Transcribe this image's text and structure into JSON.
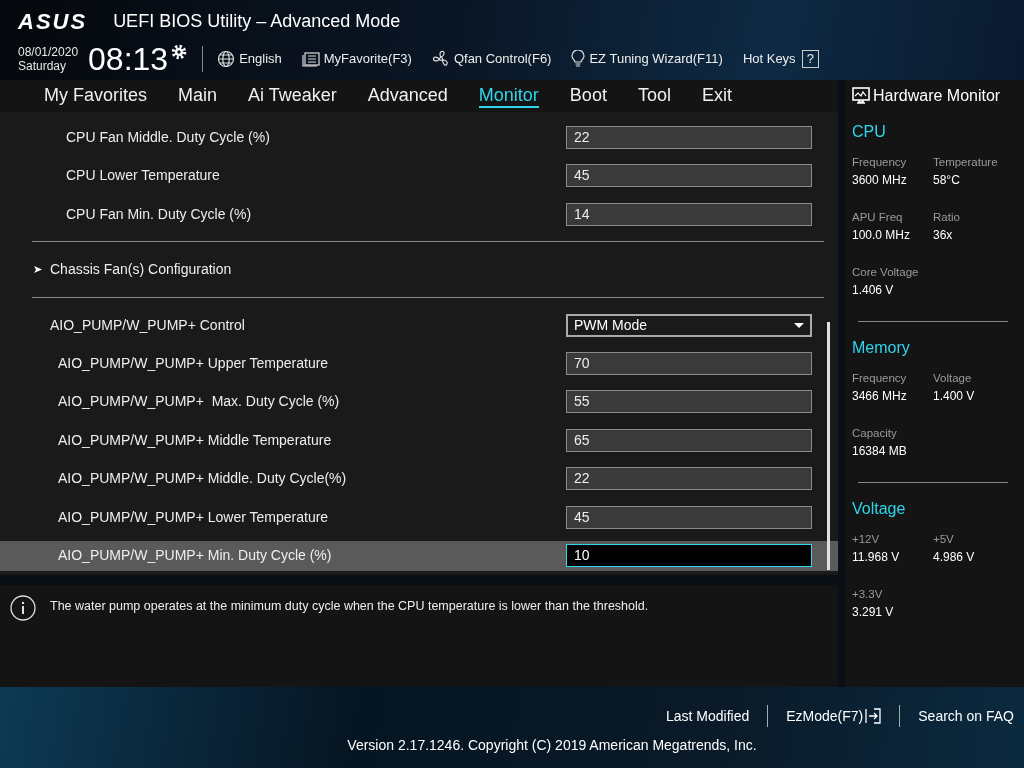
{
  "header": {
    "brand": "ASUS",
    "title": "UEFI BIOS Utility – Advanced Mode",
    "date": "08/01/2020",
    "day": "Saturday",
    "time": "08:13",
    "tools": [
      {
        "kind": "globe",
        "label": "English"
      },
      {
        "kind": "list",
        "label": "MyFavorite(F3)"
      },
      {
        "kind": "fan",
        "label": "Qfan Control(F6)"
      },
      {
        "kind": "bulb",
        "label": "EZ Tuning Wizard(F11)"
      },
      {
        "kind": "help",
        "label": "Hot Keys",
        "key": "?"
      }
    ]
  },
  "tabs": [
    {
      "label": "My Favorites",
      "selected": false
    },
    {
      "label": "Main",
      "selected": false
    },
    {
      "label": "Ai Tweaker",
      "selected": false
    },
    {
      "label": "Advanced",
      "selected": false
    },
    {
      "label": "Monitor",
      "selected": true
    },
    {
      "label": "Boot",
      "selected": false
    },
    {
      "label": "Tool",
      "selected": false
    },
    {
      "label": "Exit",
      "selected": false
    }
  ],
  "settings": [
    {
      "kind": "nested",
      "label": "CPU Fan Middle. Duty Cycle (%)",
      "value": "22",
      "selected": false
    },
    {
      "kind": "nested",
      "label": "CPU Lower Temperature",
      "value": "45",
      "selected": false
    },
    {
      "kind": "nested",
      "label": "CPU Fan Min. Duty Cycle (%)",
      "value": "14",
      "selected": false
    },
    {
      "kind": "divider"
    },
    {
      "kind": "submenu",
      "label": "Chassis Fan(s) Configuration",
      "selected": false
    },
    {
      "kind": "divider"
    },
    {
      "kind": "dropdown",
      "label": "AIO_PUMP/W_PUMP+ Control",
      "value": "PWM Mode",
      "selected": false
    },
    {
      "kind": "field",
      "label": "AIO_PUMP/W_PUMP+ Upper Temperature",
      "value": "70",
      "selected": false
    },
    {
      "kind": "field",
      "label": "AIO_PUMP/W_PUMP+  Max. Duty Cycle (%)",
      "value": "55",
      "selected": false
    },
    {
      "kind": "field",
      "label": "AIO_PUMP/W_PUMP+ Middle Temperature",
      "value": "65",
      "selected": false
    },
    {
      "kind": "field",
      "label": "AIO_PUMP/W_PUMP+ Middle. Duty Cycle(%)",
      "value": "22",
      "selected": false
    },
    {
      "kind": "field",
      "label": "AIO_PUMP/W_PUMP+ Lower Temperature",
      "value": "45",
      "selected": false
    },
    {
      "kind": "field",
      "label": "AIO_PUMP/W_PUMP+ Min. Duty Cycle (%)",
      "value": "10",
      "selected": true
    }
  ],
  "help": "The water pump operates at the minimum duty cycle when the CPU temperature is lower than the threshold.",
  "hardware_monitor": {
    "title": "Hardware Monitor",
    "sections": [
      {
        "title": "CPU",
        "items": [
          {
            "label": "Frequency",
            "value": "3600 MHz"
          },
          {
            "label": "Temperature",
            "value": "58°C"
          },
          {
            "label": "APU Freq",
            "value": "100.0 MHz"
          },
          {
            "label": "Ratio",
            "value": "36x"
          },
          {
            "label": "Core Voltage",
            "value": "1.406 V"
          }
        ]
      },
      {
        "title": "Memory",
        "items": [
          {
            "label": "Frequency",
            "value": "3466 MHz"
          },
          {
            "label": "Voltage",
            "value": "1.400 V"
          },
          {
            "label": "Capacity",
            "value": "16384 MB"
          }
        ]
      },
      {
        "title": "Voltage",
        "items": [
          {
            "label": "+12V",
            "value": "11.968 V"
          },
          {
            "label": "+5V",
            "value": "4.986 V"
          },
          {
            "label": "+3.3V",
            "value": "3.291 V"
          }
        ]
      }
    ]
  },
  "footer": {
    "links": [
      {
        "kind": "text",
        "label": "Last Modified"
      },
      {
        "kind": "exit",
        "label": "EzMode(F7)"
      },
      {
        "kind": "text",
        "label": "Search on FAQ"
      }
    ],
    "version": "Version 2.17.1246. Copyright (C) 2019 American Megatrends, Inc."
  }
}
